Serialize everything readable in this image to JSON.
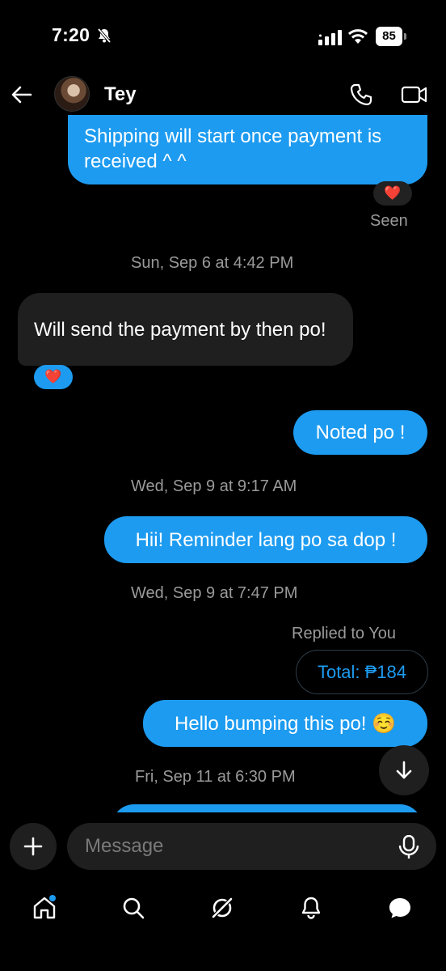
{
  "status_bar": {
    "time": "7:20",
    "battery": "85"
  },
  "header": {
    "contact_name": "Tey"
  },
  "messages": {
    "m1_text": "Shipping will start once payment is received ^ ^",
    "m1_reaction": "❤️",
    "seen": "Seen",
    "ts1": "Sun, Sep 6 at 4:42 PM",
    "m2_text": "Will send the payment by then po!",
    "m2_reaction": "❤️",
    "m3_text": "Noted po !",
    "ts2": "Wed, Sep 9 at 9:17 AM",
    "m4_text": "Hii! Reminder lang po sa dop !",
    "ts3": "Wed, Sep 9 at 7:47 PM",
    "replied_label": "Replied to You",
    "quoted_text": "Total: ₱184",
    "m5_text": "Hello bumping this po! ☺️",
    "ts4": "Fri, Sep 11 at 6:30 PM"
  },
  "composer": {
    "placeholder": "Message"
  },
  "colors": {
    "accent": "#1d9bf0",
    "incoming_bubble": "#1f1f1f",
    "background": "#000000"
  }
}
